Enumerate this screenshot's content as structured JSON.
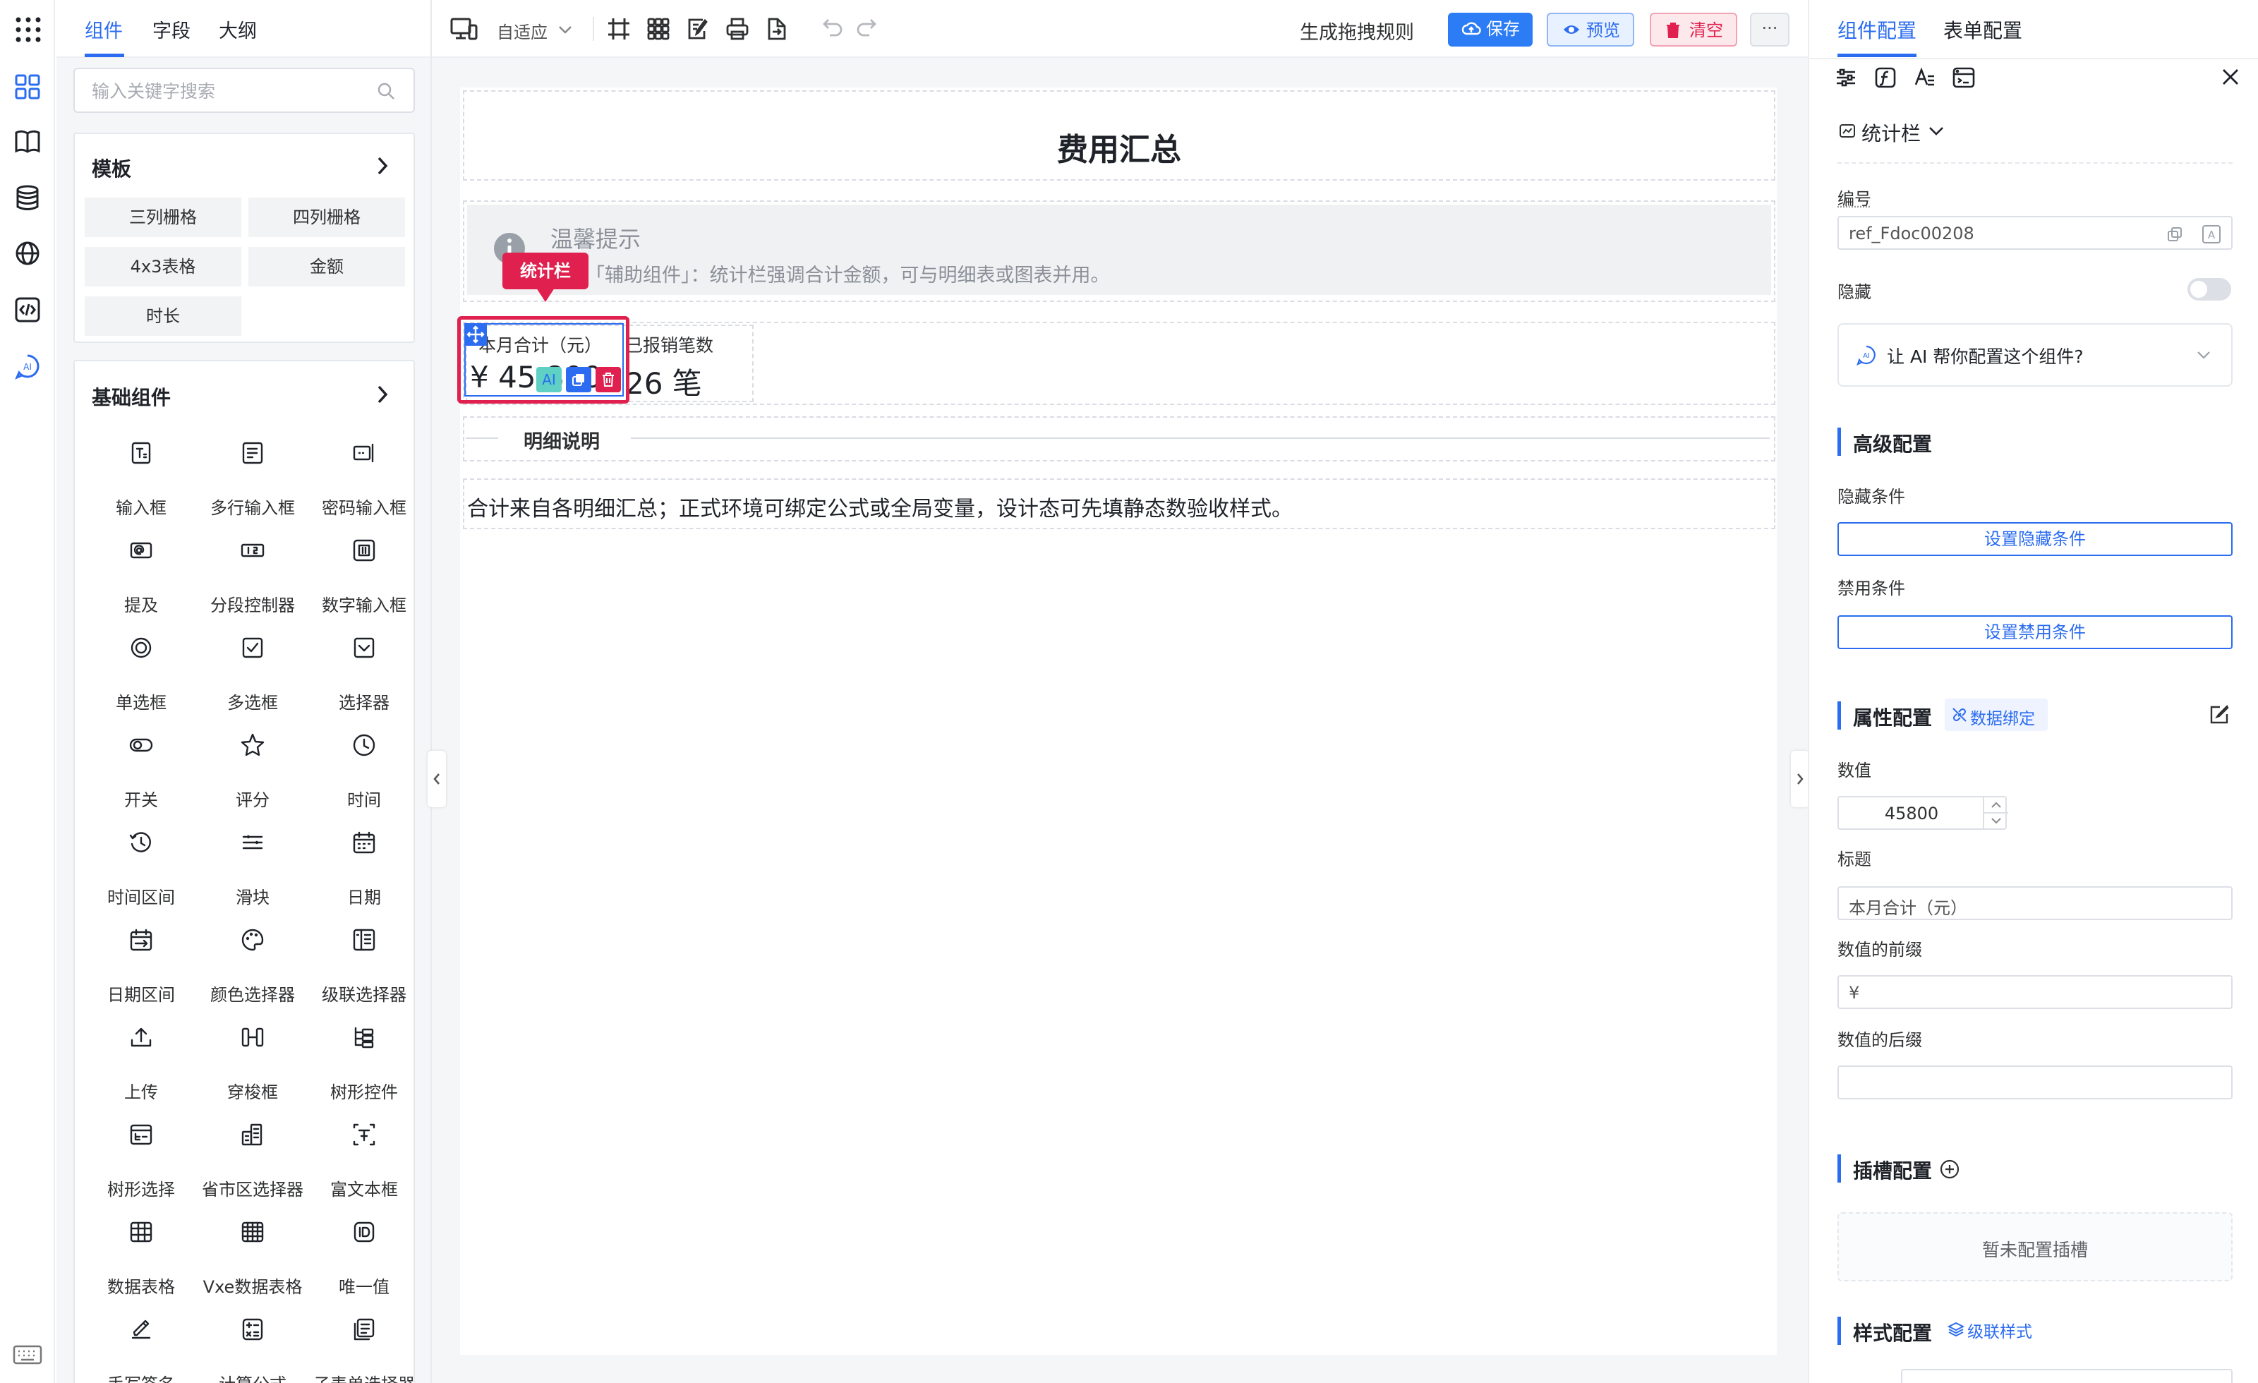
{
  "left_tabs": [
    "组件",
    "字段",
    "大纲"
  ],
  "search": {
    "placeholder": "输入关键字搜索"
  },
  "templates": {
    "title": "模板",
    "items": [
      "三列栅格",
      "四列栅格",
      "4x3表格",
      "金额",
      "时长"
    ]
  },
  "basic": {
    "title": "基础组件",
    "items": [
      {
        "label": "输入框",
        "icon": "text-input-icon"
      },
      {
        "label": "多行输入框",
        "icon": "textarea-icon"
      },
      {
        "label": "密码输入框",
        "icon": "password-input-icon"
      },
      {
        "label": "提及",
        "icon": "mention-icon"
      },
      {
        "label": "分段控制器",
        "icon": "segmented-icon"
      },
      {
        "label": "数字输入框",
        "icon": "number-input-icon"
      },
      {
        "label": "单选框",
        "icon": "radio-icon"
      },
      {
        "label": "多选框",
        "icon": "checkbox-icon"
      },
      {
        "label": "选择器",
        "icon": "select-icon"
      },
      {
        "label": "开关",
        "icon": "switch-icon"
      },
      {
        "label": "评分",
        "icon": "star-icon"
      },
      {
        "label": "时间",
        "icon": "clock-icon"
      },
      {
        "label": "时间区间",
        "icon": "time-range-icon"
      },
      {
        "label": "滑块",
        "icon": "slider-icon"
      },
      {
        "label": "日期",
        "icon": "calendar-icon"
      },
      {
        "label": "日期区间",
        "icon": "date-range-icon"
      },
      {
        "label": "颜色选择器",
        "icon": "palette-icon"
      },
      {
        "label": "级联选择器",
        "icon": "cascader-icon"
      },
      {
        "label": "上传",
        "icon": "upload-icon"
      },
      {
        "label": "穿梭框",
        "icon": "transfer-icon"
      },
      {
        "label": "树形控件",
        "icon": "tree-icon"
      },
      {
        "label": "树形选择",
        "icon": "tree-select-icon"
      },
      {
        "label": "省市区选择器",
        "icon": "region-icon"
      },
      {
        "label": "富文本框",
        "icon": "rich-text-icon"
      },
      {
        "label": "数据表格",
        "icon": "table-icon"
      },
      {
        "label": "Vxe数据表格",
        "icon": "vxe-table-icon"
      },
      {
        "label": "唯一值",
        "icon": "id-icon"
      },
      {
        "label": "手写签名",
        "icon": "signature-icon"
      },
      {
        "label": "计算公式",
        "icon": "calculator-icon"
      },
      {
        "label": "子表单选择器",
        "icon": "subform-icon"
      }
    ]
  },
  "toolbar": {
    "adaptive_label": "自适应",
    "rules_label": "生成拖拽规则",
    "save_label": "保存",
    "preview_label": "预览",
    "clear_label": "清空",
    "more_label": "···"
  },
  "form": {
    "title": "费用汇总",
    "alert": {
      "title": "温馨提示",
      "text": "「辅助组件」：统计栏强调合计金额，可与明细表或图表并用。"
    },
    "selected_tooltip": "统计栏",
    "stat1": {
      "title": "本月合计（元）",
      "value": "¥ 45,800"
    },
    "stat2": {
      "title": "已报销笔数",
      "value": "26 笔"
    },
    "divider": "明细说明",
    "text": "合计来自各明细汇总；正式环境可绑定公式或全局变量，设计态可先填静态数验收样式。",
    "ai_label": "AI"
  },
  "right": {
    "tabs": [
      "组件配置",
      "表单配置"
    ],
    "component_name": "统计栏",
    "id_label": "编号",
    "id_value": "ref_Fdoc00208",
    "hidden_label": "隐藏",
    "ai_text": "让 AI 帮你配置这个组件?",
    "advanced_title": "高级配置",
    "hide_cond_label": "隐藏条件",
    "hide_cond_btn": "设置隐藏条件",
    "disable_cond_label": "禁用条件",
    "disable_cond_btn": "设置禁用条件",
    "props_title": "属性配置",
    "data_binding": "数据绑定",
    "value_label": "数值",
    "value": "45800",
    "title_label": "标题",
    "title_value": "本月合计（元）",
    "prefix_label": "数值的前缀",
    "prefix_value": "¥",
    "suffix_label": "数值的后缀",
    "suffix_value": "",
    "slot_title": "插槽配置",
    "slot_empty": "暂未配置插槽",
    "style_title": "样式配置",
    "cascade_style": "级联样式"
  },
  "colors": {
    "accent": "#2b6cf0",
    "danger": "#e0204e",
    "selection": "#e0204e"
  }
}
